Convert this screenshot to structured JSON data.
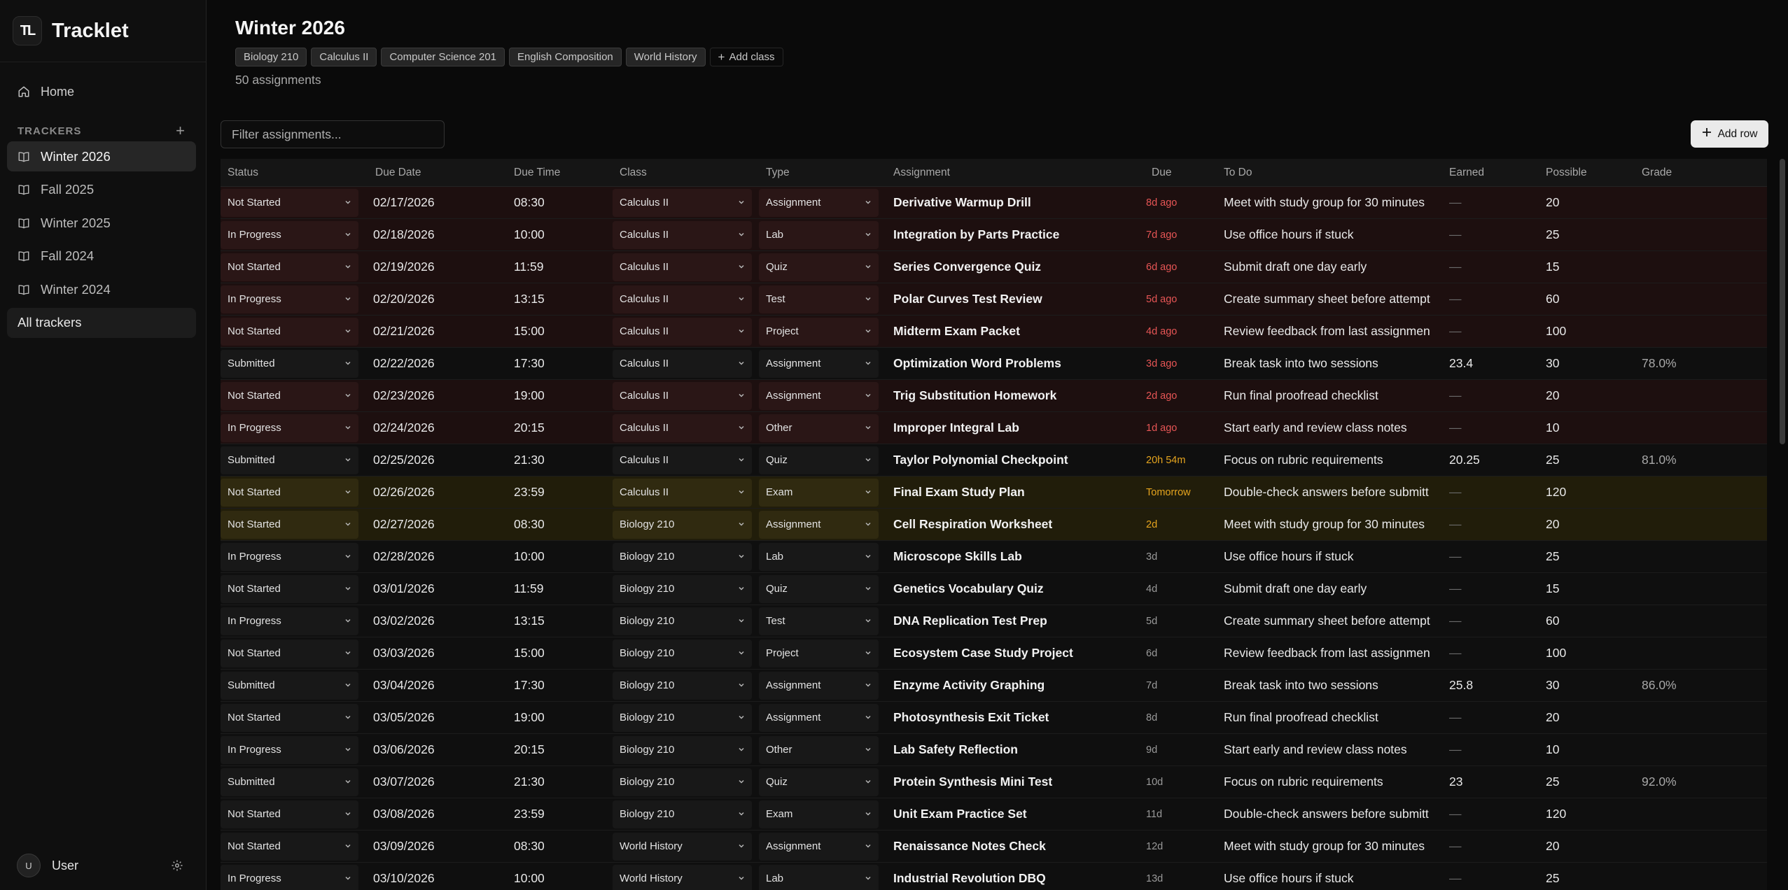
{
  "app": {
    "name": "Tracklet",
    "logo_text": "TL"
  },
  "sidebar": {
    "home_label": "Home",
    "trackers_heading": "TRACKERS",
    "trackers": [
      {
        "label": "Winter 2026",
        "active": true
      },
      {
        "label": "Fall 2025",
        "active": false
      },
      {
        "label": "Winter 2025",
        "active": false
      },
      {
        "label": "Fall 2024",
        "active": false
      },
      {
        "label": "Winter 2024",
        "active": false
      }
    ],
    "all_trackers_label": "All trackers",
    "user": {
      "initial": "U",
      "name": "User"
    }
  },
  "header": {
    "title": "Winter 2026",
    "classes": [
      "Biology 210",
      "Calculus II",
      "Computer Science 201",
      "English Composition",
      "World History"
    ],
    "add_class_label": "Add class",
    "assignment_count": "50 assignments"
  },
  "toolbar": {
    "filter_placeholder": "Filter assignments...",
    "add_row_label": "Add row"
  },
  "table": {
    "columns": [
      "Status",
      "Due Date",
      "Due Time",
      "Class",
      "Type",
      "Assignment",
      "Due",
      "To Do",
      "Earned",
      "Possible",
      "Grade"
    ],
    "rows": [
      {
        "status": "Not Started",
        "date": "02/17/2026",
        "time": "08:30",
        "class": "Calculus II",
        "type": "Assignment",
        "assignment": "Derivative Warmup Drill",
        "due": "8d ago",
        "todo": "Meet with study group for 30 minutes",
        "earned": "—",
        "possible": "20",
        "grade": "",
        "tone": "overdue",
        "due_tone": "red"
      },
      {
        "status": "In Progress",
        "date": "02/18/2026",
        "time": "10:00",
        "class": "Calculus II",
        "type": "Lab",
        "assignment": "Integration by Parts Practice",
        "due": "7d ago",
        "todo": "Use office hours if stuck",
        "earned": "—",
        "possible": "25",
        "grade": "",
        "tone": "overdue",
        "due_tone": "red"
      },
      {
        "status": "Not Started",
        "date": "02/19/2026",
        "time": "11:59",
        "class": "Calculus II",
        "type": "Quiz",
        "assignment": "Series Convergence Quiz",
        "due": "6d ago",
        "todo": "Submit draft one day early",
        "earned": "—",
        "possible": "15",
        "grade": "",
        "tone": "overdue",
        "due_tone": "red"
      },
      {
        "status": "In Progress",
        "date": "02/20/2026",
        "time": "13:15",
        "class": "Calculus II",
        "type": "Test",
        "assignment": "Polar Curves Test Review",
        "due": "5d ago",
        "todo": "Create summary sheet before attempt",
        "earned": "—",
        "possible": "60",
        "grade": "",
        "tone": "overdue",
        "due_tone": "red"
      },
      {
        "status": "Not Started",
        "date": "02/21/2026",
        "time": "15:00",
        "class": "Calculus II",
        "type": "Project",
        "assignment": "Midterm Exam Packet",
        "due": "4d ago",
        "todo": "Review feedback from last assignmen",
        "earned": "—",
        "possible": "100",
        "grade": "",
        "tone": "overdue",
        "due_tone": "red"
      },
      {
        "status": "Submitted",
        "date": "02/22/2026",
        "time": "17:30",
        "class": "Calculus II",
        "type": "Assignment",
        "assignment": "Optimization Word Problems",
        "due": "3d ago",
        "todo": "Break task into two sessions",
        "earned": "23.4",
        "possible": "30",
        "grade": "78.0%",
        "tone": "normal",
        "due_tone": "red"
      },
      {
        "status": "Not Started",
        "date": "02/23/2026",
        "time": "19:00",
        "class": "Calculus II",
        "type": "Assignment",
        "assignment": "Trig Substitution Homework",
        "due": "2d ago",
        "todo": "Run final proofread checklist",
        "earned": "—",
        "possible": "20",
        "grade": "",
        "tone": "overdue",
        "due_tone": "red"
      },
      {
        "status": "In Progress",
        "date": "02/24/2026",
        "time": "20:15",
        "class": "Calculus II",
        "type": "Other",
        "assignment": "Improper Integral Lab",
        "due": "1d ago",
        "todo": "Start early and review class notes",
        "earned": "—",
        "possible": "10",
        "grade": "",
        "tone": "overdue",
        "due_tone": "red"
      },
      {
        "status": "Submitted",
        "date": "02/25/2026",
        "time": "21:30",
        "class": "Calculus II",
        "type": "Quiz",
        "assignment": "Taylor Polynomial Checkpoint",
        "due": "20h 54m",
        "todo": "Focus on rubric requirements",
        "earned": "20.25",
        "possible": "25",
        "grade": "81.0%",
        "tone": "normal",
        "due_tone": "amber"
      },
      {
        "status": "Not Started",
        "date": "02/26/2026",
        "time": "23:59",
        "class": "Calculus II",
        "type": "Exam",
        "assignment": "Final Exam Study Plan",
        "due": "Tomorrow",
        "todo": "Double-check answers before submitt",
        "earned": "—",
        "possible": "120",
        "grade": "",
        "tone": "soon",
        "due_tone": "amber"
      },
      {
        "status": "Not Started",
        "date": "02/27/2026",
        "time": "08:30",
        "class": "Biology 210",
        "type": "Assignment",
        "assignment": "Cell Respiration Worksheet",
        "due": "2d",
        "todo": "Meet with study group for 30 minutes",
        "earned": "—",
        "possible": "20",
        "grade": "",
        "tone": "soon",
        "due_tone": "amber"
      },
      {
        "status": "In Progress",
        "date": "02/28/2026",
        "time": "10:00",
        "class": "Biology 210",
        "type": "Lab",
        "assignment": "Microscope Skills Lab",
        "due": "3d",
        "todo": "Use office hours if stuck",
        "earned": "—",
        "possible": "25",
        "grade": "",
        "tone": "normal",
        "due_tone": "gray"
      },
      {
        "status": "Not Started",
        "date": "03/01/2026",
        "time": "11:59",
        "class": "Biology 210",
        "type": "Quiz",
        "assignment": "Genetics Vocabulary Quiz",
        "due": "4d",
        "todo": "Submit draft one day early",
        "earned": "—",
        "possible": "15",
        "grade": "",
        "tone": "normal",
        "due_tone": "gray"
      },
      {
        "status": "In Progress",
        "date": "03/02/2026",
        "time": "13:15",
        "class": "Biology 210",
        "type": "Test",
        "assignment": "DNA Replication Test Prep",
        "due": "5d",
        "todo": "Create summary sheet before attempt",
        "earned": "—",
        "possible": "60",
        "grade": "",
        "tone": "normal",
        "due_tone": "gray"
      },
      {
        "status": "Not Started",
        "date": "03/03/2026",
        "time": "15:00",
        "class": "Biology 210",
        "type": "Project",
        "assignment": "Ecosystem Case Study Project",
        "due": "6d",
        "todo": "Review feedback from last assignmen",
        "earned": "—",
        "possible": "100",
        "grade": "",
        "tone": "normal",
        "due_tone": "gray"
      },
      {
        "status": "Submitted",
        "date": "03/04/2026",
        "time": "17:30",
        "class": "Biology 210",
        "type": "Assignment",
        "assignment": "Enzyme Activity Graphing",
        "due": "7d",
        "todo": "Break task into two sessions",
        "earned": "25.8",
        "possible": "30",
        "grade": "86.0%",
        "tone": "normal",
        "due_tone": "gray"
      },
      {
        "status": "Not Started",
        "date": "03/05/2026",
        "time": "19:00",
        "class": "Biology 210",
        "type": "Assignment",
        "assignment": "Photosynthesis Exit Ticket",
        "due": "8d",
        "todo": "Run final proofread checklist",
        "earned": "—",
        "possible": "20",
        "grade": "",
        "tone": "normal",
        "due_tone": "gray"
      },
      {
        "status": "In Progress",
        "date": "03/06/2026",
        "time": "20:15",
        "class": "Biology 210",
        "type": "Other",
        "assignment": "Lab Safety Reflection",
        "due": "9d",
        "todo": "Start early and review class notes",
        "earned": "—",
        "possible": "10",
        "grade": "",
        "tone": "normal",
        "due_tone": "gray"
      },
      {
        "status": "Submitted",
        "date": "03/07/2026",
        "time": "21:30",
        "class": "Biology 210",
        "type": "Quiz",
        "assignment": "Protein Synthesis Mini Test",
        "due": "10d",
        "todo": "Focus on rubric requirements",
        "earned": "23",
        "possible": "25",
        "grade": "92.0%",
        "tone": "normal",
        "due_tone": "gray"
      },
      {
        "status": "Not Started",
        "date": "03/08/2026",
        "time": "23:59",
        "class": "Biology 210",
        "type": "Exam",
        "assignment": "Unit Exam Practice Set",
        "due": "11d",
        "todo": "Double-check answers before submitt",
        "earned": "—",
        "possible": "120",
        "grade": "",
        "tone": "normal",
        "due_tone": "gray"
      },
      {
        "status": "Not Started",
        "date": "03/09/2026",
        "time": "08:30",
        "class": "World History",
        "type": "Assignment",
        "assignment": "Renaissance Notes Check",
        "due": "12d",
        "todo": "Meet with study group for 30 minutes",
        "earned": "—",
        "possible": "20",
        "grade": "",
        "tone": "normal",
        "due_tone": "gray"
      },
      {
        "status": "In Progress",
        "date": "03/10/2026",
        "time": "10:00",
        "class": "World History",
        "type": "Lab",
        "assignment": "Industrial Revolution DBQ",
        "due": "13d",
        "todo": "Use office hours if stuck",
        "earned": "—",
        "possible": "25",
        "grade": "",
        "tone": "normal",
        "due_tone": "gray"
      }
    ]
  }
}
